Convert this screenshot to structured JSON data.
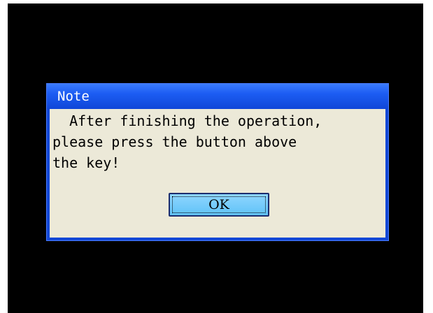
{
  "dialog": {
    "title": "Note",
    "message_line1": "  After finishing the operation,",
    "message_line2": "please press the button above",
    "message_line3": "the key!",
    "ok_label": "OK"
  },
  "colors": {
    "background": "#000000",
    "titlebar": "#1c5cf2",
    "body": "#ece9d8",
    "button": "#5fc2f7"
  }
}
